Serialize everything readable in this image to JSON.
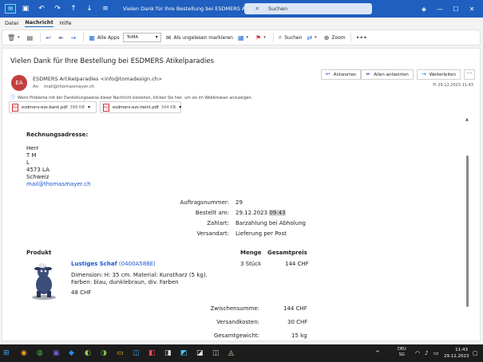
{
  "titlebar": {
    "title": "Vielen Dank für Ihre Bestellung bei ESDMERS Atikelparadies - Nachricht (HT...",
    "search_placeholder": "Suchen"
  },
  "menubar": {
    "items": [
      "Datei",
      "Nachricht",
      "Hilfe"
    ]
  },
  "ribbon": {
    "all_apps": "Alle Apps",
    "folder_value": "ToMA",
    "mark_unread": "Als ungelesen markieren",
    "search": "Suchen",
    "zoom": "Zoom"
  },
  "email": {
    "subject": "Vielen Dank für Ihre Bestellung bei ESDMERS Atikelparadies",
    "avatar_initials": "EA",
    "sender": "ESDMERS Artikelparadies <info@tomadesign.ch>",
    "to_label": "An",
    "to_value": "mail@thomasmayer.ch",
    "date": "Fr 29.12.2023 11:43",
    "info": "Wenn Probleme mit der Darstellungsweise dieser Nachricht bestehen, klicken Sie hier, um sie im Webbrowser anzuzeigen.",
    "reply": "Antworten",
    "reply_all": "Allen antworten",
    "forward": "Weiterleiten",
    "attachments": [
      {
        "name": "esdmers-ezs-bank.pdf",
        "size": "399 KB"
      },
      {
        "name": "esdmers-ezs-twint.pdf",
        "size": "344 KB"
      }
    ]
  },
  "body": {
    "billing_heading": "Rechnungsadresse:",
    "billing_lines": [
      "Herr",
      "T M",
      "L",
      "4573 LA",
      "Schweiz"
    ],
    "billing_email": "mail@thomasmayer.ch",
    "order": {
      "number_label": "Auftragsnummer:",
      "number_value": "29",
      "ordered_label": "Bestellt am:",
      "ordered_date": "29.12.2023",
      "ordered_time": "09:43",
      "payment_label": "Zahlart:",
      "payment_value": "Barzahlung bei Abholung",
      "shipping_label": "Versandart:",
      "shipping_value": "Lieferung per Post"
    },
    "table": {
      "col_product": "Produkt",
      "col_qty": "Menge",
      "col_total": "Gesamtpreis"
    },
    "item": {
      "name": "Lustiges Schaf",
      "code": "(0400A588E)",
      "qty": "3 Stück",
      "total": "144 CHF",
      "desc1": "Dimension: H: 35 cm. Material: Kunstharz (5 kg).",
      "desc2": "Farben: blau, dunklebraun, div. Farben",
      "unit_price": "48 CHF"
    },
    "totals": {
      "subtotal_label": "Zwischensumme:",
      "subtotal_value": "144 CHF",
      "shipping_label": "Versandkosten:",
      "shipping_value": "30 CHF",
      "weight_label": "Gesamtgewicht:",
      "weight_value": "15 kg"
    }
  },
  "taskbar": {
    "lang1": "DEU",
    "lang2": "SG",
    "time": "11:43",
    "date": "29.12.2023"
  }
}
